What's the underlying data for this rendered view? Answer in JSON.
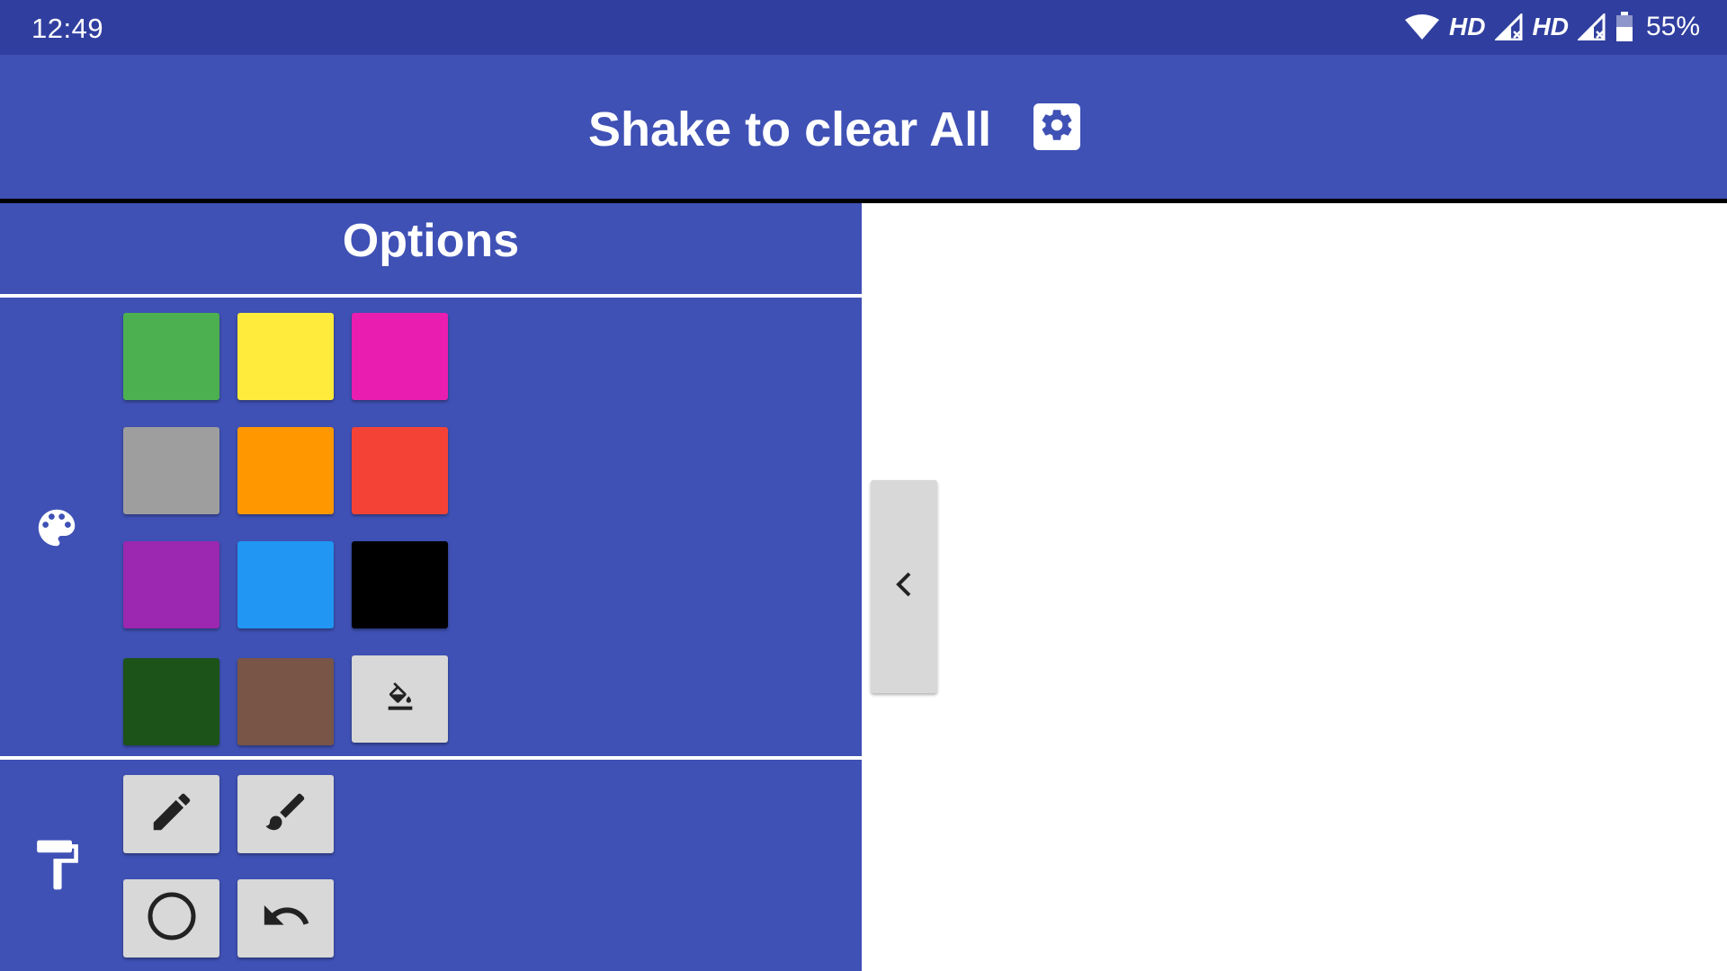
{
  "status_bar": {
    "time": "12:49",
    "network_label_1": "HD",
    "network_label_2": "HD",
    "battery": "55%"
  },
  "app_bar": {
    "title": "Shake to clear All",
    "settings_icon": "gear-icon"
  },
  "options": {
    "title": "Options",
    "palette_icon": "palette-icon",
    "colors": [
      {
        "name": "green",
        "hex": "#4caf50"
      },
      {
        "name": "yellow",
        "hex": "#ffeb3b"
      },
      {
        "name": "pink",
        "hex": "#e91eb0"
      },
      {
        "name": "grey",
        "hex": "#9e9e9e"
      },
      {
        "name": "orange",
        "hex": "#ff9800"
      },
      {
        "name": "red",
        "hex": "#f44336"
      },
      {
        "name": "purple",
        "hex": "#9c27b0"
      },
      {
        "name": "blue",
        "hex": "#2196f3"
      },
      {
        "name": "black",
        "hex": "#000000"
      },
      {
        "name": "dark-green",
        "hex": "#1b5318"
      },
      {
        "name": "brown",
        "hex": "#795548"
      }
    ],
    "fill_tool_icon": "paint-bucket-icon",
    "brush_section_icon": "paint-roller-icon",
    "tools": [
      "pencil-icon",
      "brush-icon",
      "circle-icon",
      "undo-icon"
    ]
  },
  "drawer": {
    "toggle_icon": "chevron-left-icon"
  },
  "theme": {
    "primary": "#3f51b5",
    "primary_dark": "#303f9f",
    "button_bg": "#d7d8d7"
  }
}
